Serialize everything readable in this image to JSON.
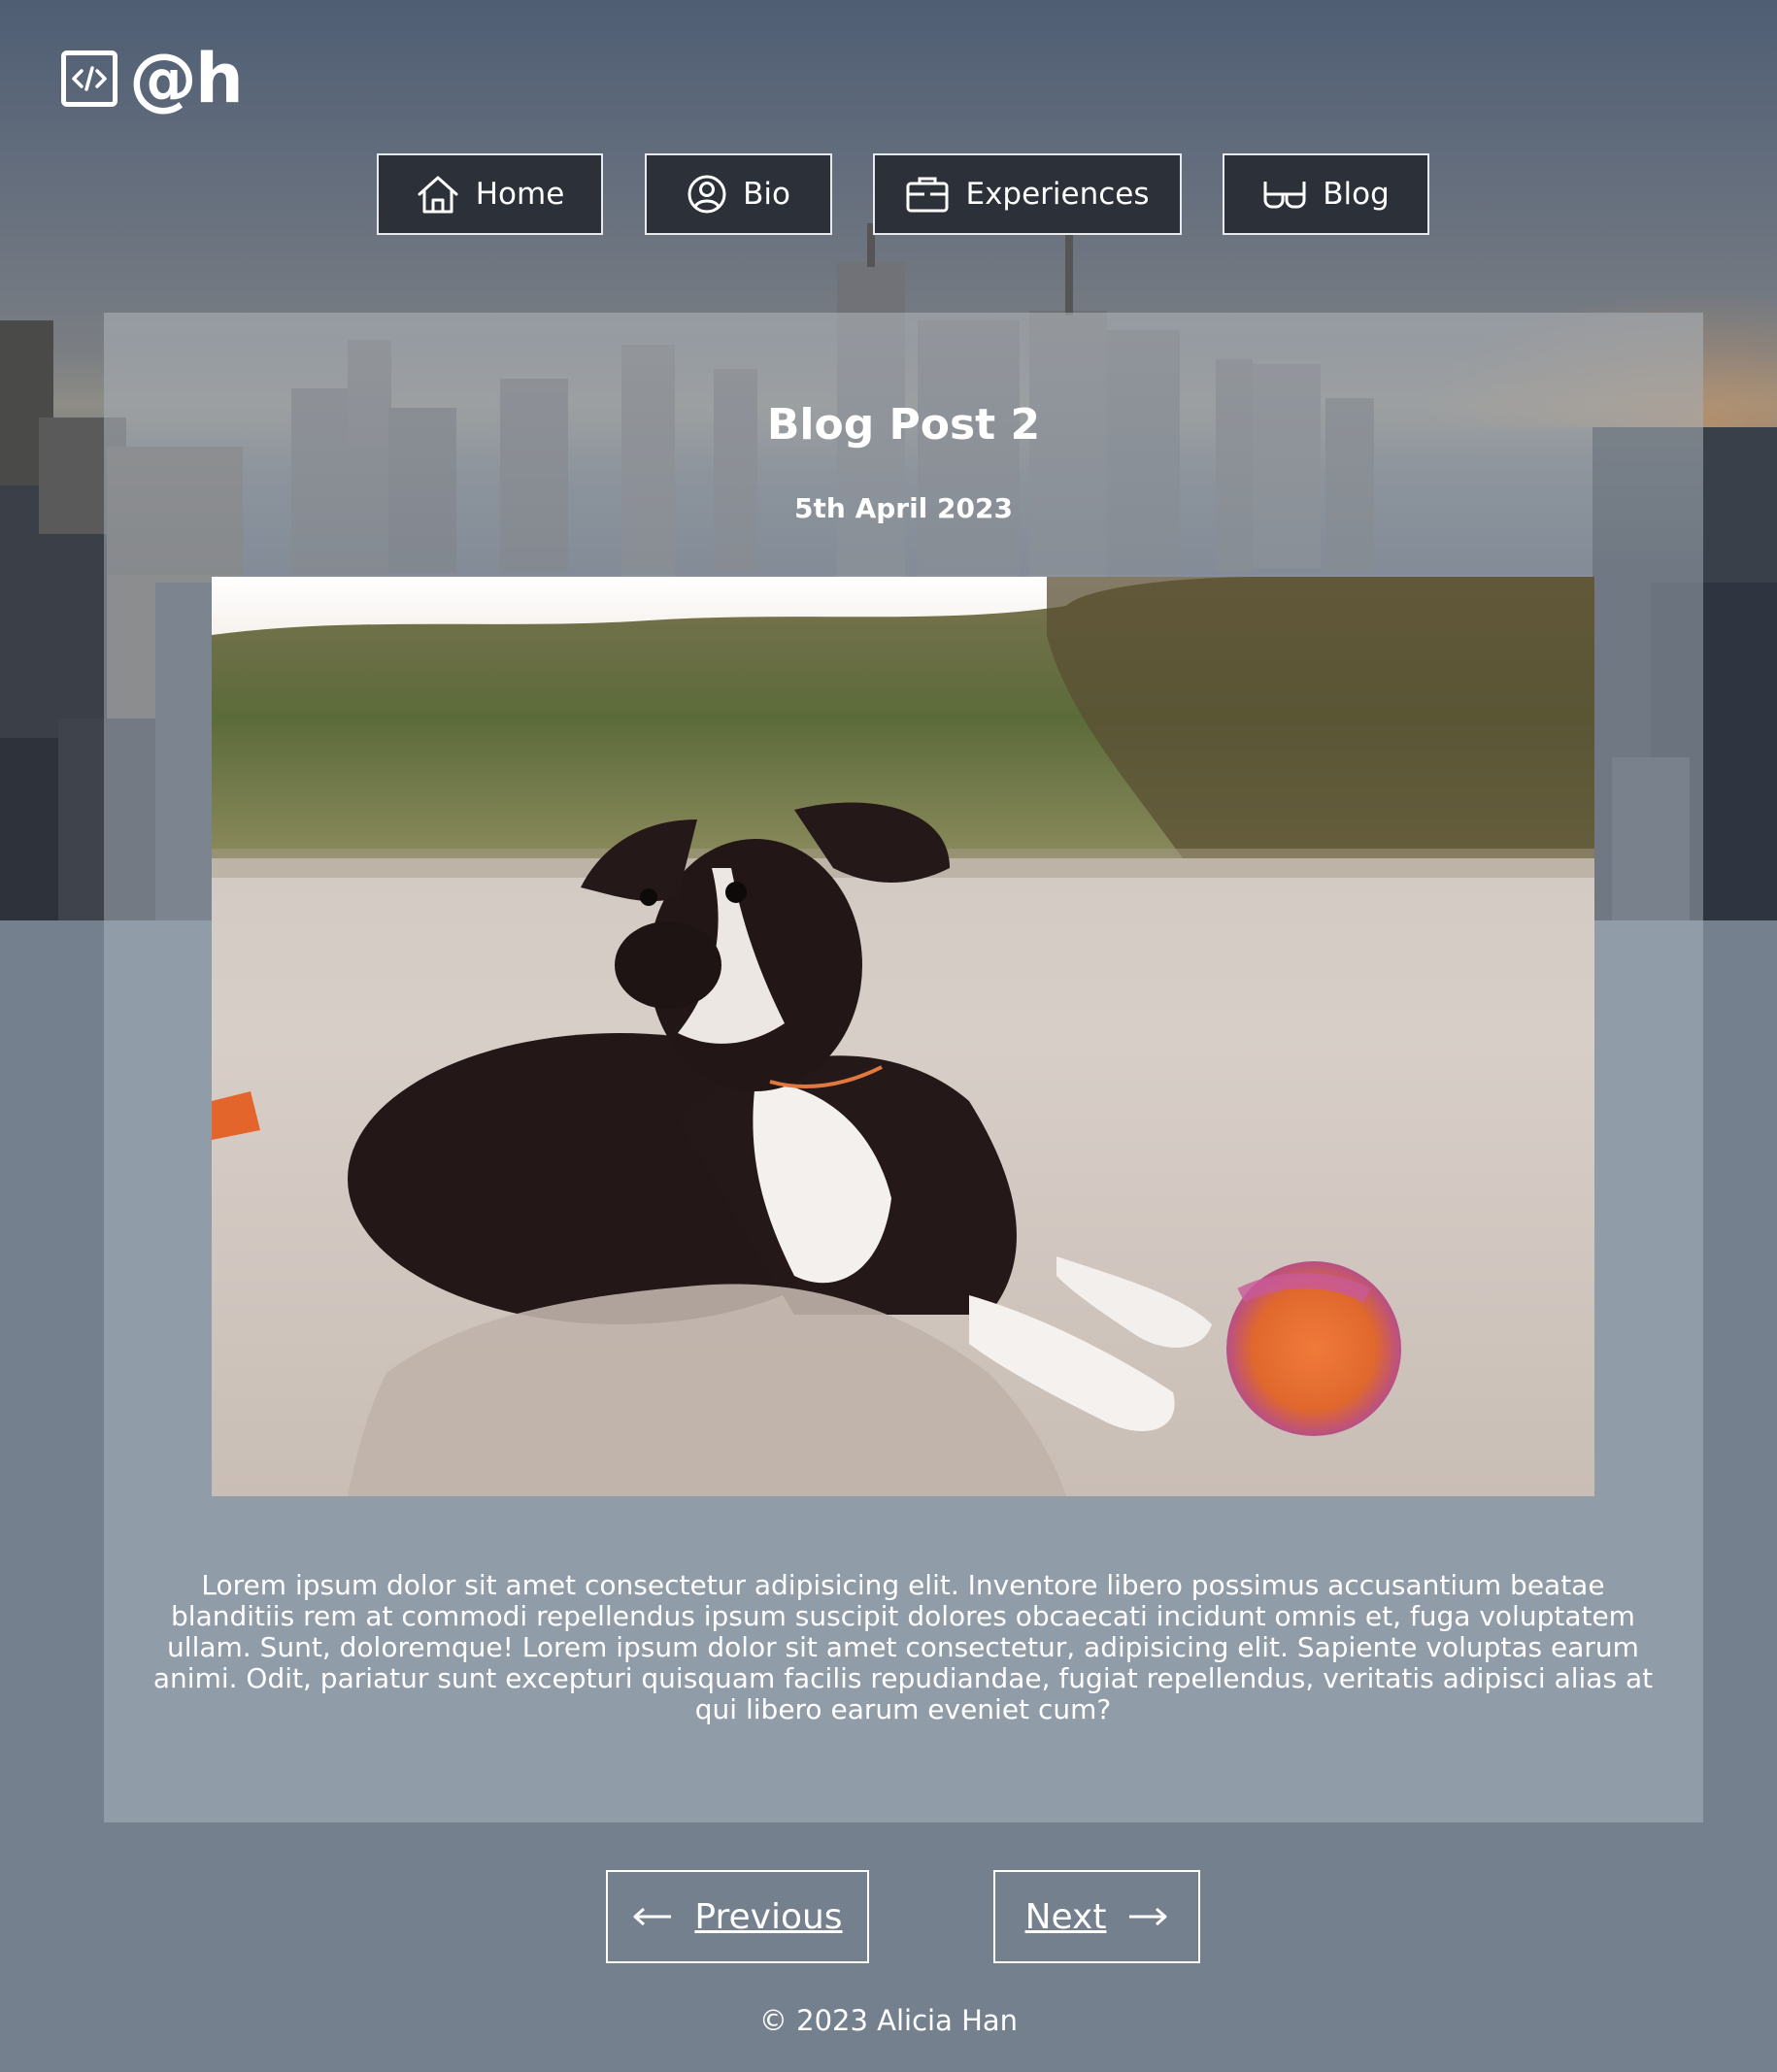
{
  "logo": {
    "text": "@h",
    "icon": "code-icon"
  },
  "nav": {
    "items": [
      {
        "label": "Home",
        "icon": "home-icon"
      },
      {
        "label": "Bio",
        "icon": "user-circle-icon"
      },
      {
        "label": "Experiences",
        "icon": "briefcase-icon"
      },
      {
        "label": "Blog",
        "icon": "glasses-icon"
      }
    ]
  },
  "post": {
    "title": "Blog Post 2",
    "date": "5th April 2023",
    "image": "puppy-on-beach-photo",
    "body": "Lorem ipsum dolor sit amet consectetur adipisicing elit. Inventore libero possimus accusantium beatae blanditiis rem at commodi repellendus ipsum suscipit dolores obcaecati incidunt omnis et, fuga voluptatem ullam. Sunt, doloremque! Lorem ipsum dolor sit amet consectetur, adipisicing elit. Sapiente voluptas earum animi. Odit, pariatur sunt excepturi quisquam facilis repudiandae, fugiat repellendus, veritatis adipisci alias at qui libero earum eveniet cum?"
  },
  "pager": {
    "previous_label": "Previous",
    "next_label": "Next",
    "previous_icon": "arrow-left-icon",
    "next_icon": "arrow-right-icon"
  },
  "footer": {
    "text": "© 2023 Alicia Han"
  },
  "colors": {
    "page_bg": "#75808f",
    "nav_button_bg": "#2c3038",
    "card_bg": "#9ea8b4"
  }
}
